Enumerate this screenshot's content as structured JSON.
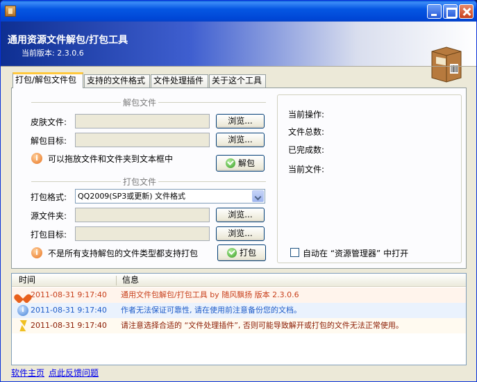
{
  "header": {
    "title": "通用资源文件解包/打包工具",
    "version": "当前版本: 2.3.0.6"
  },
  "tabs": [
    {
      "label": "打包/解包文件包",
      "active": true
    },
    {
      "label": "支持的文件格式",
      "active": false
    },
    {
      "label": "文件处理插件",
      "active": false
    },
    {
      "label": "关于这个工具",
      "active": false
    }
  ],
  "unpack": {
    "legend": "解包文件",
    "skin_file_label": "皮肤文件:",
    "target_label": "解包目标:",
    "browse_label": "浏览...",
    "hint": "可以拖放文件和文件夹到文本框中",
    "unpack_button": "解包",
    "skin_file_value": "",
    "target_value": ""
  },
  "pack": {
    "legend": "打包文件",
    "format_label": "打包格式:",
    "format_value": "QQ2009(SP3或更新) 文件格式",
    "source_label": "源文件夹:",
    "target_label": "打包目标:",
    "browse_label": "浏览...",
    "hint": "不是所有支持解包的文件类型都支持打包",
    "pack_button": "打包",
    "source_value": "",
    "target_value": ""
  },
  "status": {
    "current_op_label": "当前操作:",
    "total_files_label": "文件总数:",
    "done_label": "已完成数:",
    "current_file_label": "当前文件:",
    "auto_open_label": "自动在 “资源管理器” 中打开",
    "auto_open_checked": false
  },
  "log": {
    "columns": [
      "时间",
      "信息"
    ],
    "rows": [
      {
        "icon": "heart-icon",
        "time": "2011-08-31 9:17:40",
        "message": "通用文件包解包/打包工具 by 随风飘扬 版本 2.3.0.6",
        "color": "#c8401c",
        "bg": "#fff4ec"
      },
      {
        "icon": "info-icon",
        "time": "2011-08-31 9:17:40",
        "message": "作者无法保证可靠性, 请在使用前注意备份您的文档。",
        "color": "#1f5cc8",
        "bg": "#eaf2fd"
      },
      {
        "icon": "lightning-icon",
        "time": "2011-08-31 9:17:40",
        "message": "请注意选择合适的 “文件处理插件”, 否则可能导致解开或打包的文件无法正常使用。",
        "color": "#8a1a00",
        "bg": "#fffaf0"
      }
    ]
  },
  "footer": {
    "home_link": "软件主页",
    "feedback_link": "点此反馈问题"
  },
  "colors": {
    "titlebar": "#0046d5",
    "accent_tab": "#ffc83c",
    "link": "#0000ee"
  }
}
